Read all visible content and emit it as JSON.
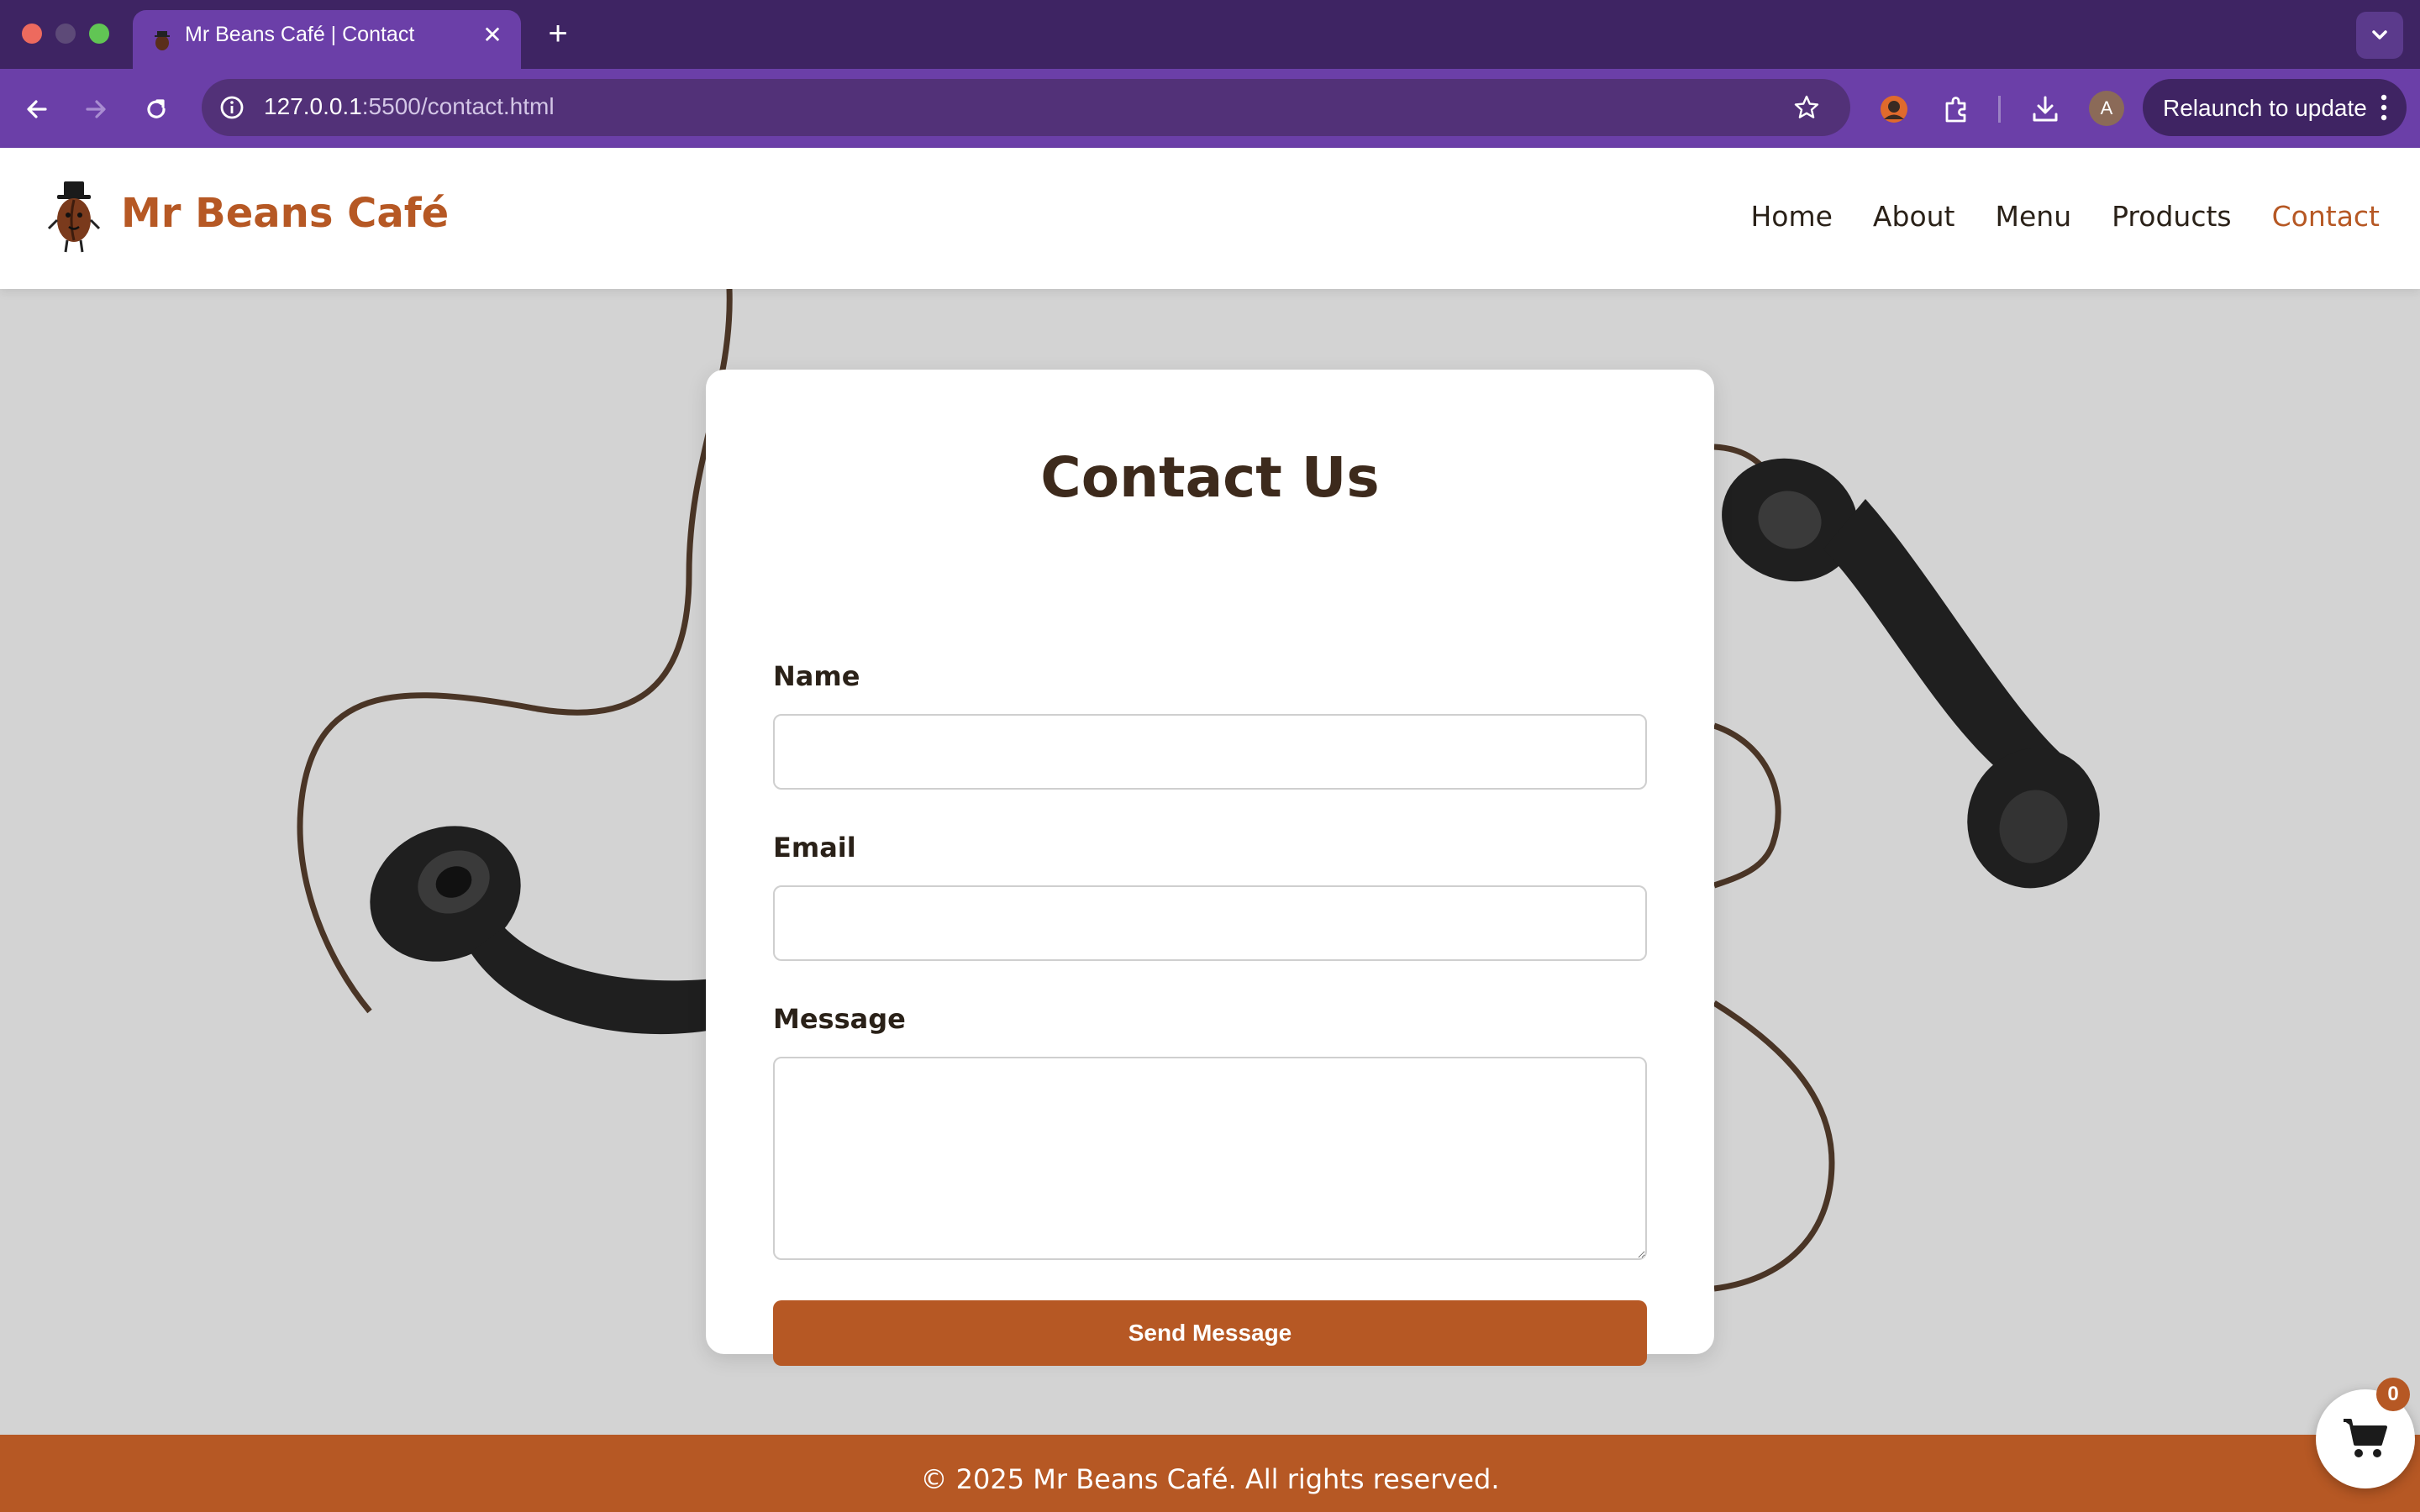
{
  "browser": {
    "tab_title": "Mr Beans Café | Contact",
    "url_host": "127.0.0.1",
    "url_rest": ":5500/contact.html",
    "avatar_letter": "A",
    "relaunch_label": "Relaunch to update",
    "colors": {
      "tabbar": "#3e2463",
      "toolbar": "#6b3fa8"
    }
  },
  "site": {
    "brand": "Mr Beans Café",
    "nav": {
      "home": "Home",
      "about": "About",
      "menu": "Menu",
      "products": "Products",
      "contact": "Contact"
    },
    "active_nav": "Contact",
    "accent_color": "#b65824"
  },
  "form": {
    "heading": "Contact Us",
    "name_label": "Name",
    "name_value": "",
    "email_label": "Email",
    "email_value": "",
    "message_label": "Message",
    "message_value": "",
    "submit_label": "Send Message"
  },
  "footer": {
    "text": "© 2025 Mr Beans Café. All rights reserved."
  },
  "cart": {
    "count": "0",
    "icon": "cart-icon"
  }
}
